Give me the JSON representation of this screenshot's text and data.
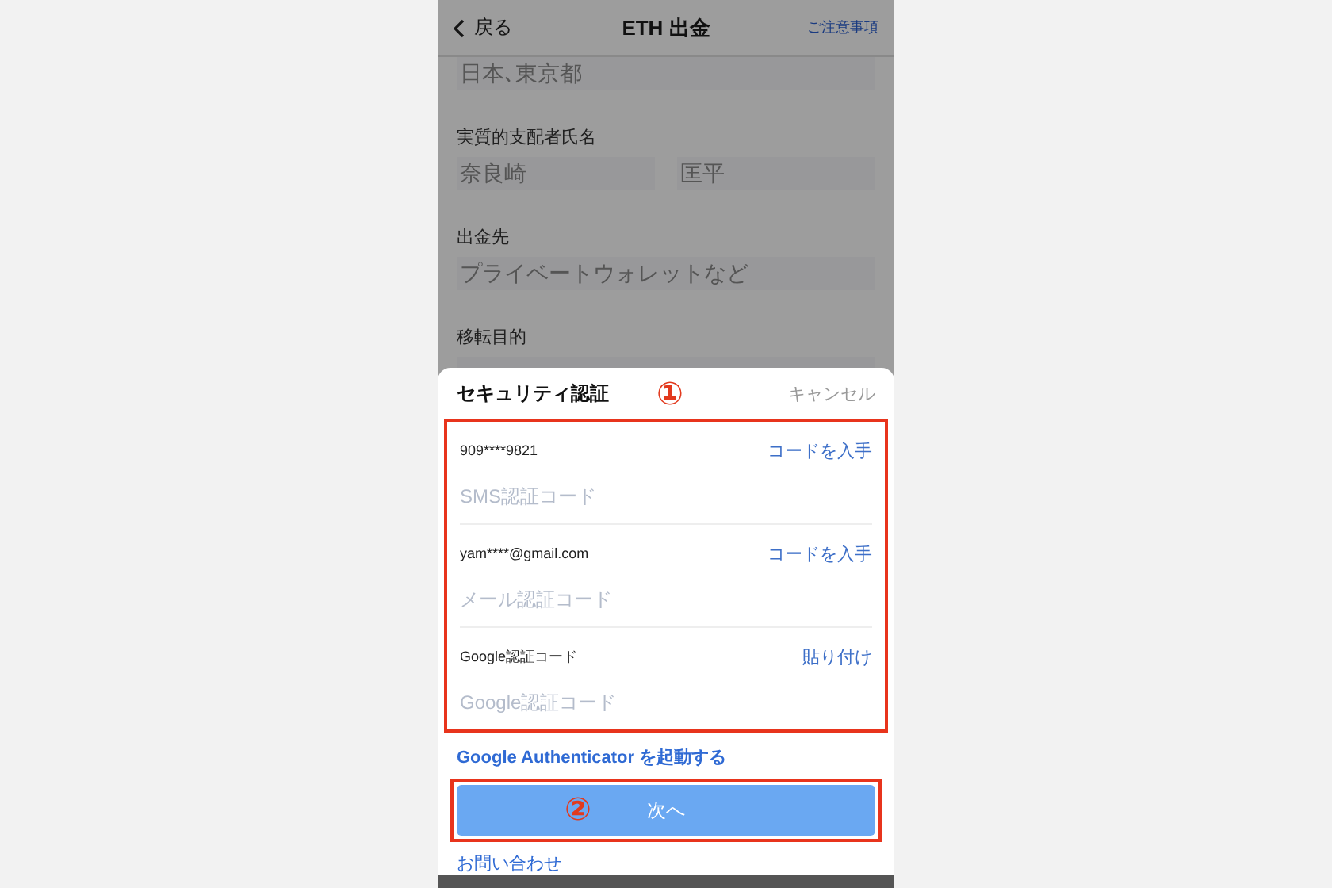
{
  "nav": {
    "back": "戻る",
    "title": "ETH 出金",
    "notice": "ご注意事項"
  },
  "form": {
    "top_field": "日本､東京都",
    "groups": [
      {
        "label": "実質的支配者氏名",
        "fields": [
          "奈良崎",
          "匡平"
        ]
      },
      {
        "label": "出金先",
        "fields": [
          "プライベートウォレットなど"
        ]
      },
      {
        "label": "移転目的"
      }
    ]
  },
  "sheet": {
    "title": "セキュリティ認証",
    "callout": "①",
    "cancel": "キャンセル",
    "methods": [
      {
        "label": "909****9821",
        "action": "コードを入手",
        "placeholder": "SMS認証コード"
      },
      {
        "label": "yam****@gmail.com",
        "action": "コードを入手",
        "placeholder": "メール認証コード"
      },
      {
        "label": "Google認証コード",
        "action": "貼り付け",
        "placeholder": "Google認証コード"
      }
    ],
    "authenticator_link": "Google Authenticator を起動する",
    "next": {
      "callout": "②",
      "label": "次へ"
    },
    "contact": "お問い合わせ"
  }
}
